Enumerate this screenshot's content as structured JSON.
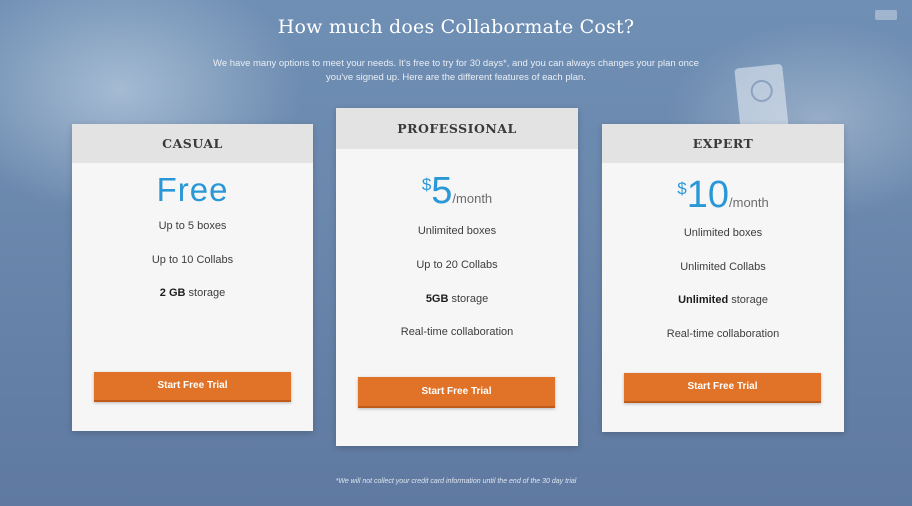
{
  "header": {
    "title": "How much does Collabormate Cost?",
    "subtitle": "We have many options to meet your needs. It's free to try for 30 days*, and you can always changes your plan once you've signed up. Here are the different features of each plan."
  },
  "plans": [
    {
      "name": "CASUAL",
      "price": "Free",
      "features": [
        "Up to 5 boxes",
        "Up to 10 Collabs"
      ],
      "storage": {
        "bold": "2 GB",
        "suffix": " storage"
      },
      "cta": "Start Free Trial"
    },
    {
      "name": "PROFESSIONAL",
      "currency": "$",
      "amount": "5",
      "period": "/month",
      "features": [
        "Unlimited boxes",
        "Up to 20 Collabs"
      ],
      "storage": {
        "bold": "5GB",
        "suffix": " storage"
      },
      "extra": "Real-time collaboration",
      "cta": "Start Free Trial"
    },
    {
      "name": "EXPERT",
      "currency": "$",
      "amount": "10",
      "period": "/month",
      "features": [
        "Unlimited boxes",
        "Unlimited Collabs"
      ],
      "storage": {
        "bold": "Unlimited",
        "suffix": " storage"
      },
      "extra": "Real-time collaboration",
      "cta": "Start Free Trial"
    }
  ],
  "footnote": "*We will not collect your credit card information until the end of the 30 day trial",
  "colors": {
    "accent_blue": "#2a97d6",
    "button_orange": "#e07328",
    "background": "#6b88ad"
  }
}
